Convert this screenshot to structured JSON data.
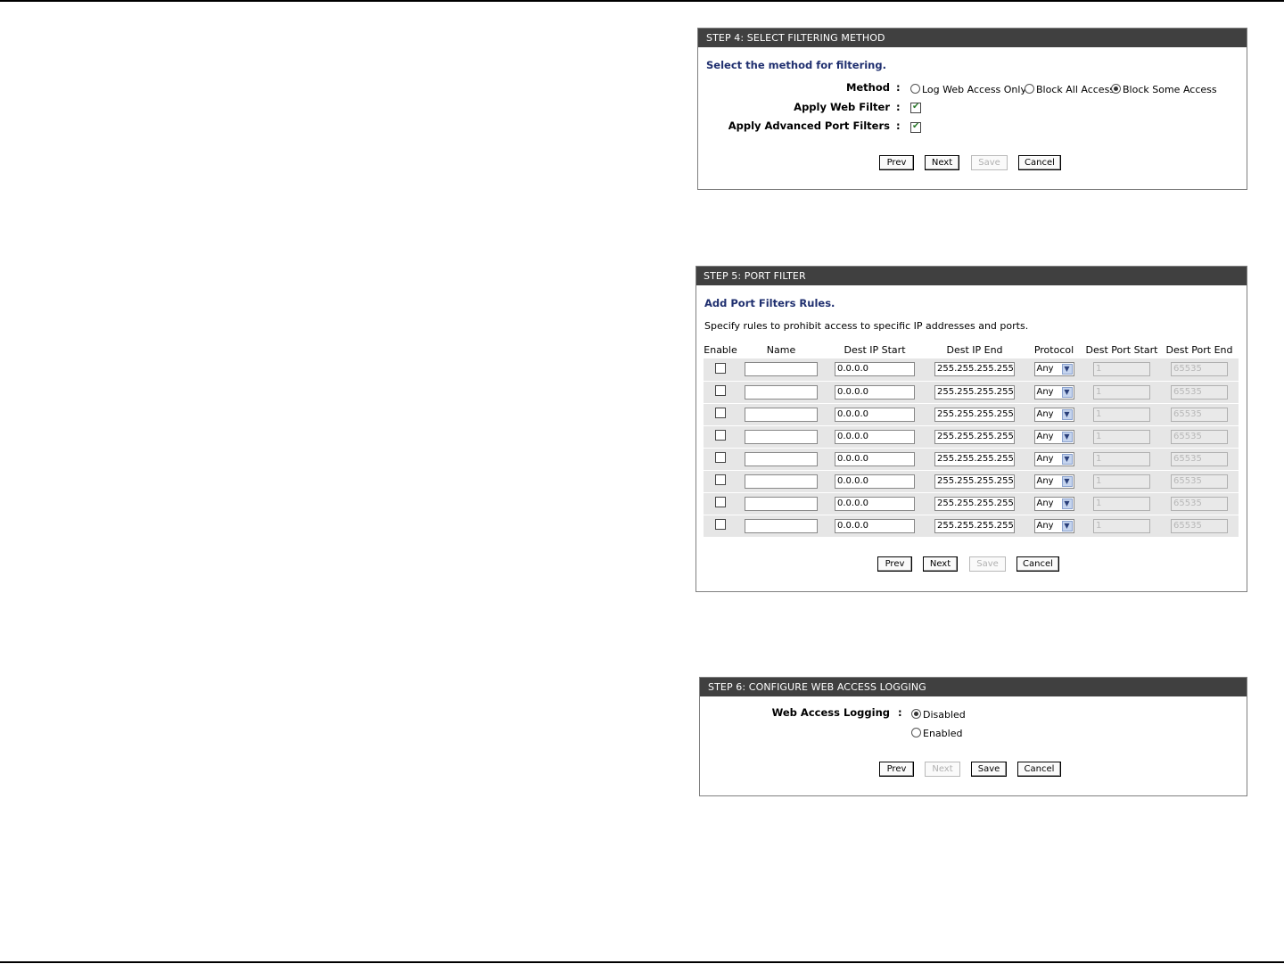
{
  "step4": {
    "title": "STEP 4: SELECT FILTERING METHOD",
    "intro": "Select the method for filtering.",
    "method_label": "Method",
    "colon": ":",
    "method_options": [
      {
        "label": "Log Web Access Only",
        "checked": false
      },
      {
        "label": "Block All Access",
        "checked": false
      },
      {
        "label": "Block Some Access",
        "checked": true
      }
    ],
    "web_filter_label": "Apply Web Filter",
    "web_filter_checked": true,
    "port_filters_label": "Apply Advanced Port Filters",
    "port_filters_checked": true,
    "buttons": {
      "prev": "Prev",
      "next": "Next",
      "save": "Save",
      "cancel": "Cancel"
    },
    "save_disabled": true
  },
  "step5": {
    "title": "STEP 5: PORT FILTER",
    "intro": "Add Port Filters Rules.",
    "description": "Specify rules to prohibit access to specific IP addresses and ports.",
    "columns": [
      "Enable",
      "Name",
      "Dest IP Start",
      "Dest IP End",
      "Protocol",
      "Dest Port Start",
      "Dest Port End"
    ],
    "rows": [
      {
        "enabled": false,
        "name": "",
        "ip_start": "0.0.0.0",
        "ip_end": "255.255.255.255",
        "protocol": "Any",
        "port_start": "1",
        "port_end": "65535"
      },
      {
        "enabled": false,
        "name": "",
        "ip_start": "0.0.0.0",
        "ip_end": "255.255.255.255",
        "protocol": "Any",
        "port_start": "1",
        "port_end": "65535"
      },
      {
        "enabled": false,
        "name": "",
        "ip_start": "0.0.0.0",
        "ip_end": "255.255.255.255",
        "protocol": "Any",
        "port_start": "1",
        "port_end": "65535"
      },
      {
        "enabled": false,
        "name": "",
        "ip_start": "0.0.0.0",
        "ip_end": "255.255.255.255",
        "protocol": "Any",
        "port_start": "1",
        "port_end": "65535"
      },
      {
        "enabled": false,
        "name": "",
        "ip_start": "0.0.0.0",
        "ip_end": "255.255.255.255",
        "protocol": "Any",
        "port_start": "1",
        "port_end": "65535"
      },
      {
        "enabled": false,
        "name": "",
        "ip_start": "0.0.0.0",
        "ip_end": "255.255.255.255",
        "protocol": "Any",
        "port_start": "1",
        "port_end": "65535"
      },
      {
        "enabled": false,
        "name": "",
        "ip_start": "0.0.0.0",
        "ip_end": "255.255.255.255",
        "protocol": "Any",
        "port_start": "1",
        "port_end": "65535"
      },
      {
        "enabled": false,
        "name": "",
        "ip_start": "0.0.0.0",
        "ip_end": "255.255.255.255",
        "protocol": "Any",
        "port_start": "1",
        "port_end": "65535"
      }
    ],
    "buttons": {
      "prev": "Prev",
      "next": "Next",
      "save": "Save",
      "cancel": "Cancel"
    },
    "save_disabled": true
  },
  "step6": {
    "title": "STEP 6: CONFIGURE WEB ACCESS LOGGING",
    "logging_label": "Web Access Logging",
    "colon": ":",
    "options": [
      {
        "label": "Disabled",
        "checked": true
      },
      {
        "label": "Enabled",
        "checked": false
      }
    ],
    "buttons": {
      "prev": "Prev",
      "next": "Next",
      "save": "Save",
      "cancel": "Cancel"
    },
    "next_disabled": true
  },
  "colors": {
    "header_bg": "#404040",
    "title_blue": "#1f2f6f",
    "row_bg": "#e6e6e6"
  }
}
